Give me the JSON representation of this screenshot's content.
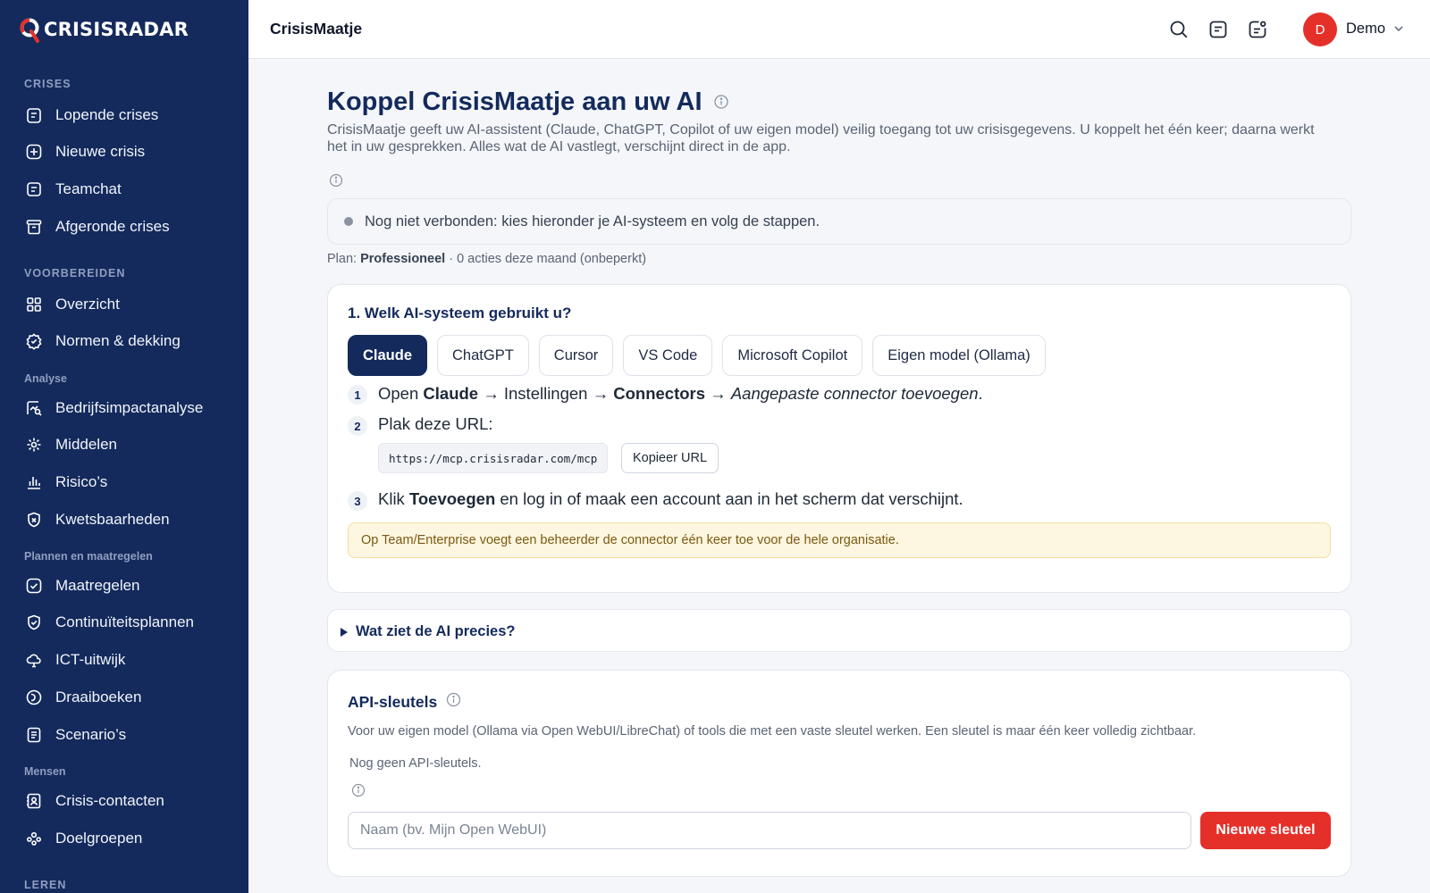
{
  "brand": {
    "name": "CRISISRADAR",
    "accent": "#e5302a",
    "sidebar_bg": "#142a5c"
  },
  "sidebar": {
    "sections": [
      {
        "title": "CRISES",
        "items": [
          {
            "label": "Lopende crises",
            "icon": "clipboard-icon"
          },
          {
            "label": "Nieuwe crisis",
            "icon": "plus-square-icon"
          },
          {
            "label": "Teamchat",
            "icon": "chat-icon"
          },
          {
            "label": "Afgeronde crises",
            "icon": "archive-icon"
          }
        ]
      },
      {
        "title": "VOORBEREIDEN",
        "items": [
          {
            "label": "Overzicht",
            "icon": "grid-icon"
          },
          {
            "label": "Normen & dekking",
            "icon": "badge-check-icon"
          }
        ]
      },
      {
        "title": "Analyse",
        "items": [
          {
            "label": "Bedrijfsimpactanalyse",
            "icon": "chart-search-icon"
          },
          {
            "label": "Middelen",
            "icon": "network-icon"
          },
          {
            "label": "Risico’s",
            "icon": "bar-chart-icon"
          },
          {
            "label": "Kwetsbaarheden",
            "icon": "shield-x-icon"
          }
        ]
      },
      {
        "title": "Plannen en maatregelen",
        "items": [
          {
            "label": "Maatregelen",
            "icon": "check-square-icon"
          },
          {
            "label": "Continuïteitsplannen",
            "icon": "shield-check-icon"
          },
          {
            "label": "ICT-uitwijk",
            "icon": "cloud-icon"
          },
          {
            "label": "Draaiboeken",
            "icon": "book-icon"
          },
          {
            "label": "Scenario’s",
            "icon": "file-text-icon"
          }
        ]
      },
      {
        "title": "Mensen",
        "items": [
          {
            "label": "Crisis-contacten",
            "icon": "contact-card-icon"
          },
          {
            "label": "Doelgroepen",
            "icon": "people-icon"
          }
        ]
      },
      {
        "title": "LEREN",
        "items": []
      }
    ]
  },
  "header": {
    "title": "CrisisMaatje",
    "user": {
      "initial": "D",
      "name": "Demo"
    }
  },
  "main": {
    "title": "Koppel CrisisMaatje aan uw AI",
    "lead": "CrisisMaatje geeft uw AI-assistent (Claude, ChatGPT, Copilot of uw eigen model) veilig toegang tot uw crisisgegevens. U koppelt het één keer; daarna werkt het in uw gesprekken. Alles wat de AI vastlegt, verschijnt direct in de app.",
    "status": "Nog niet verbonden: kies hieronder je AI-systeem en volg de stappen.",
    "plan": {
      "prefix": "Plan: ",
      "name": "Professioneel",
      "suffix": " · 0 acties deze maand (onbeperkt)"
    },
    "step_card": {
      "title": "1. Welk AI-systeem gebruikt u?",
      "tabs": [
        "Claude",
        "ChatGPT",
        "Cursor",
        "VS Code",
        "Microsoft Copilot",
        "Eigen model (Ollama)"
      ],
      "active_tab": "Claude",
      "steps": [
        {
          "no": "1",
          "t1": "Open ",
          "b1": "Claude",
          "t2": " → Instellingen → ",
          "b2": "Connectors",
          "t3": " → ",
          "i1": "Aangepaste connector toevoegen",
          "t4": "."
        },
        {
          "no": "2",
          "text": "Plak deze URL:"
        },
        {
          "no": "3",
          "t1": "Klik ",
          "b1": "Toevoegen",
          "t2": " en log in of maak een account aan in het scherm dat verschijnt."
        }
      ],
      "url": "https://mcp.crisisradar.com/mcp",
      "copy_label": "Kopieer URL",
      "note": "Op Team/Enterprise voegt een beheerder de connector één keer toe voor de hele organisatie."
    },
    "details_label": "Wat ziet de AI precies?",
    "api": {
      "title": "API-sleutels",
      "description": "Voor uw eigen model (Ollama via Open WebUI/LibreChat) of tools die met een vaste sleutel werken. Een sleutel is maar één keer volledig zichtbaar.",
      "empty": "Nog geen API-sleutels.",
      "input_placeholder": "Naam (bv. Mijn Open WebUI)",
      "button": "Nieuwe sleutel"
    }
  }
}
